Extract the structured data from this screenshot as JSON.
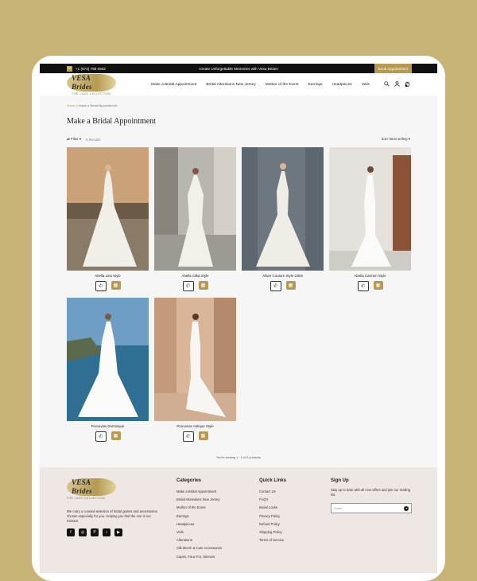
{
  "topbar": {
    "phone": "+1 (973) 798-2562",
    "promo": "Create Unforgettable Memories with Vesa Brides",
    "book_label": "Book Appointment"
  },
  "brand": {
    "logo_text": "VESA Brides",
    "tagline": "THE LUXE COLLECTION",
    "accent": "#b59a52"
  },
  "nav": {
    "items": [
      "Make a Bridal Appointment",
      "Bridal Alterations New Jersey",
      "Mother of the Event",
      "Earrings",
      "Headpieces",
      "Veils"
    ]
  },
  "header_icons": [
    "search-icon",
    "account-icon",
    "cart-icon"
  ],
  "breadcrumb": {
    "home": "Home",
    "sep": ">",
    "current": "Make a Bridal Appointment"
  },
  "page_title": "Make a Bridal Appointment",
  "filter": {
    "label": "Filter",
    "results": "6 Results",
    "sort": "Sort: Best selling"
  },
  "products": [
    {
      "name": "Abella Lina Style"
    },
    {
      "name": "Abella Cilka Style"
    },
    {
      "name": "Allure Couture Style C803"
    },
    {
      "name": "Abella Carmen Style"
    },
    {
      "name": "Pronovias Dominique"
    },
    {
      "name": "Pronovias Antique Style"
    }
  ],
  "viewing_text": "You're viewing 1 - 6 of 6 products",
  "footer": {
    "about": "We carry a curated selection of bridal gowns and accessories chosen especially for you. Helping you find the one is our mission.",
    "socials": [
      "facebook-icon",
      "instagram-icon",
      "pinterest-icon",
      "tiktok-icon",
      "youtube-icon"
    ],
    "categories_title": "Categories",
    "categories": [
      "Make a Bridal Appointment",
      "Bridal Alterations New Jersey",
      "Mother of the Event",
      "Earrings",
      "Headpieces",
      "Veils",
      "Alterations",
      "Silk Merch & Cute Accessories",
      "Capes, Faux Fur, Sleeves"
    ],
    "quick_title": "Quick Links",
    "quick": [
      "Contact Us",
      "FAQ's",
      "Bridal Looks",
      "Privacy Policy",
      "Refund Policy",
      "Shipping Policy",
      "Terms of Service"
    ],
    "signup_title": "Sign Up",
    "signup_desc": "Stay up to date with all new offers and join our mailing list.",
    "email_placeholder": "Email"
  }
}
